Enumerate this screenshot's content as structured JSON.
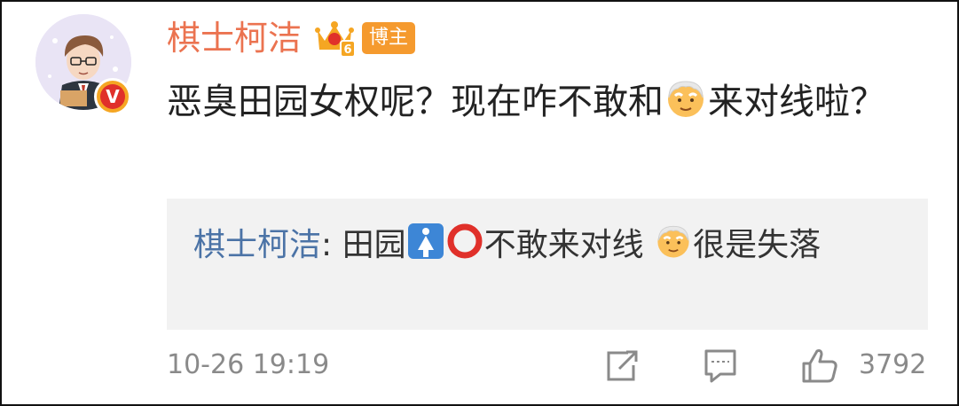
{
  "post": {
    "username": "棋士柯洁",
    "role_badge": "博主",
    "crown_level": "6",
    "verified_mark": "V",
    "text_part1": "恶臭田园女权呢？现在咋不敢和",
    "text_emoji": "old-man-emoji",
    "text_part2": "来对线啦？"
  },
  "quote": {
    "user": "棋士柯洁",
    "separator": ": ",
    "text_part1": "田园",
    "emoji1": "woman-symbol-icon",
    "emoji2": "red-circle-icon",
    "text_part2": "不敢来对线 ",
    "emoji3": "old-man-emoji",
    "text_part3": "很是失落"
  },
  "footer": {
    "timestamp": "10-26 19:19",
    "like_count": "3792"
  },
  "colors": {
    "username": "#eb7350",
    "quote_user": "#4b73a6",
    "badge": "#f59a2e",
    "meta_gray": "#8a8a8a",
    "quote_bg": "#f2f2f2"
  }
}
